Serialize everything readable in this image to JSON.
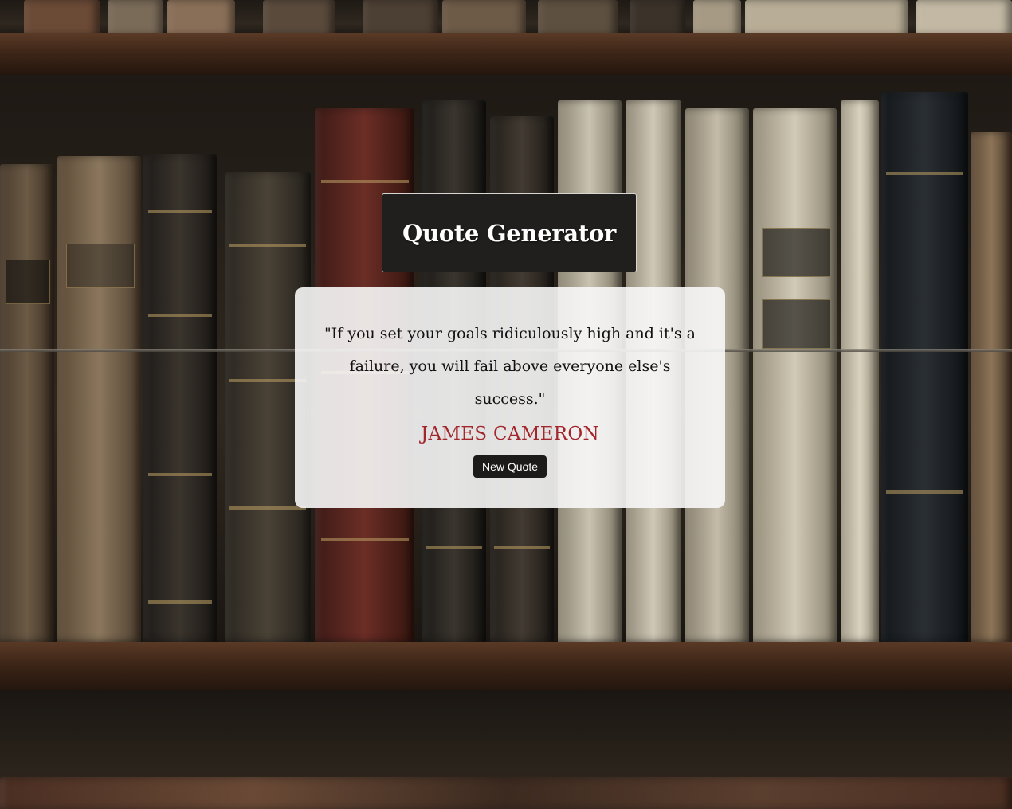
{
  "header": {
    "title": "Quote Generator"
  },
  "quote": {
    "text": "\"If you set your goals ridiculously high and it's a failure, you will fail above everyone else's success.\"",
    "author": "JAMES CAMERON"
  },
  "actions": {
    "new_quote_label": "New Quote"
  },
  "colors": {
    "author": "#a3262c",
    "title_background": "#211f1e",
    "button_background": "#1d1b1a",
    "card_background": "#f7f7f7"
  }
}
